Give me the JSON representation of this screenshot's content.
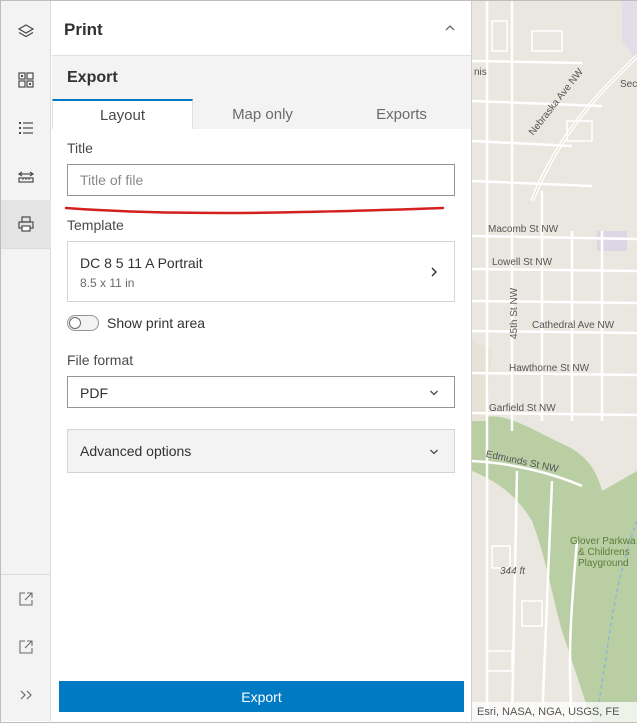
{
  "panel": {
    "title": "Print",
    "subheader": "Export",
    "tabs": [
      {
        "label": "Layout",
        "active": true
      },
      {
        "label": "Map only",
        "active": false
      },
      {
        "label": "Exports",
        "active": false
      }
    ],
    "title_field": {
      "label": "Title",
      "placeholder": "Title of file",
      "value": ""
    },
    "template": {
      "label": "Template",
      "name": "DC 8 5 11 A Portrait",
      "size": "8.5 x 11 in"
    },
    "show_print_area": {
      "label": "Show print area",
      "checked": false
    },
    "file_format": {
      "label": "File format",
      "value": "PDF"
    },
    "advanced_options": {
      "label": "Advanced options"
    },
    "export_button": "Export"
  },
  "rail": {
    "icons": [
      "layers-icon",
      "basemap-gallery-icon",
      "legend-icon",
      "measure-icon",
      "print-icon",
      "launch-icon",
      "launch-icon-2",
      "expand-icon"
    ],
    "active": "print-icon"
  },
  "map": {
    "labels": {
      "nis": "nis",
      "sec": "Sec",
      "nebraska": "Nebraska Ave NW",
      "macomb": "Macomb St NW",
      "lowell": "Lowell St NW",
      "st45": "45th St NW",
      "cathedral": "Cathedral Ave NW",
      "hawthorne": "Hawthorne St NW",
      "garfield": "Garfield St NW",
      "edmunds": "Edmunds St NW",
      "glover1": "Glover Parkwa",
      "glover2": "& Childrens",
      "glover3": "Playground",
      "elevation": "344 ft"
    },
    "attribution": "Esri, NASA, NGA, USGS, FE"
  },
  "colors": {
    "accent": "#007ac2",
    "annotation": "#d42020",
    "park": "#b7cfa0"
  }
}
